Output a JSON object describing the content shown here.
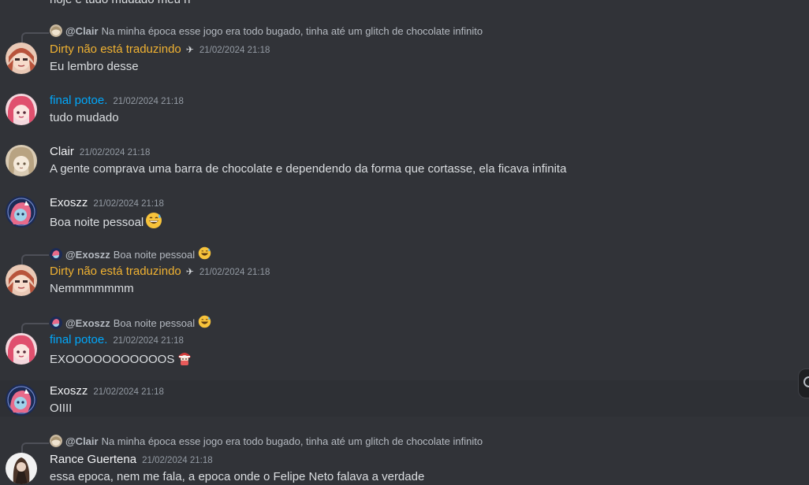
{
  "top_cut_text": "hoje é tudo mudado meu n",
  "messages": [
    {
      "reply": {
        "name": "@Clair",
        "text": "Na minha época esse jogo era todo bugado, tinha até um glitch de chocolate infinito"
      },
      "username": "Dirty não está traduzindo",
      "timestamp": "21/02/2024 21:18",
      "badge": "✈",
      "text": "Eu lembro desse"
    },
    {
      "username": "final potoe.",
      "timestamp": "21/02/2024 21:18",
      "text": "tudo mudado"
    },
    {
      "username": "Clair",
      "timestamp": "21/02/2024 21:18",
      "text": "A gente comprava uma barra de chocolate e dependendo da forma que cortasse, ela ficava infinita"
    },
    {
      "username": "Exoszz",
      "timestamp": "21/02/2024 21:18",
      "text": "Boa noite pessoal"
    },
    {
      "reply": {
        "name": "@Exoszz",
        "text": "Boa noite pessoal"
      },
      "username": "Dirty não está traduzindo",
      "timestamp": "21/02/2024 21:18",
      "badge": "✈",
      "text": "Nemmmmmmm"
    },
    {
      "reply": {
        "name": "@Exoszz",
        "text": "Boa noite pessoal"
      },
      "username": "final potoe.",
      "timestamp": "21/02/2024 21:18",
      "text": "EXOOOOOOOOOOOS"
    },
    {
      "username": "Exoszz",
      "timestamp": "21/02/2024 21:18",
      "text": "OIIII"
    },
    {
      "reply": {
        "name": "@Clair",
        "text": "Na minha época esse jogo era todo bugado, tinha até um glitch de chocolate infinito"
      },
      "username": "Rance Guertena",
      "timestamp": "21/02/2024 21:18",
      "text": "essa epoca, nem me fala, a epoca onde o Felipe Neto falava a verdade"
    }
  ],
  "colors": {
    "background": "#313338",
    "dirty_name": "#f0b232",
    "final_name": "#00a8fc",
    "timestamp": "#949ba4"
  }
}
